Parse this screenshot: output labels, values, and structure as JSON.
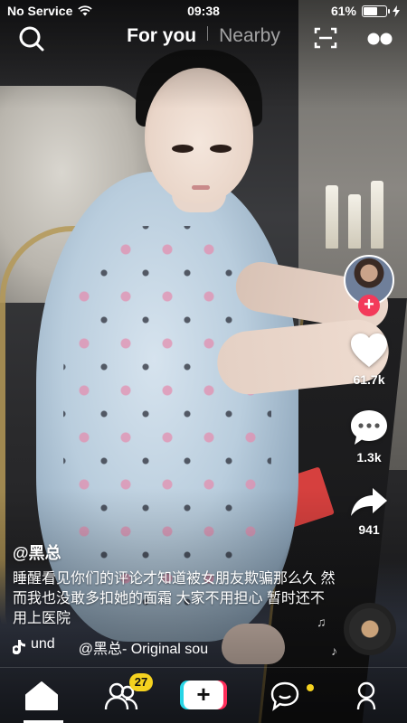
{
  "status_bar": {
    "carrier": "No Service",
    "time": "09:38",
    "battery": "61%",
    "battery_level": 0.61
  },
  "top_nav": {
    "tab_for_you": "For you",
    "tab_nearby": "Nearby",
    "icons": [
      "search-icon",
      "scan-icon",
      "more-icon"
    ]
  },
  "rail": {
    "likes": "61.7k",
    "comments": "1.3k",
    "shares": "941",
    "follow_symbol": "+"
  },
  "post": {
    "username": "@黑总",
    "caption": "睡醒看见你们的评论才知道被女朋友欺骗那么久 然而我也没敢多扣她的面霜 大家不用担心 暂时还不用上医院",
    "sound_prefix": "und",
    "sound_text": "@黑总- Original sou"
  },
  "bottom_nav": {
    "friends_badge": "27",
    "add_symbol": "+",
    "accent_yellow": "#f5d21f",
    "accent_red": "#ff2e5a",
    "accent_cyan": "#27d5e6"
  }
}
